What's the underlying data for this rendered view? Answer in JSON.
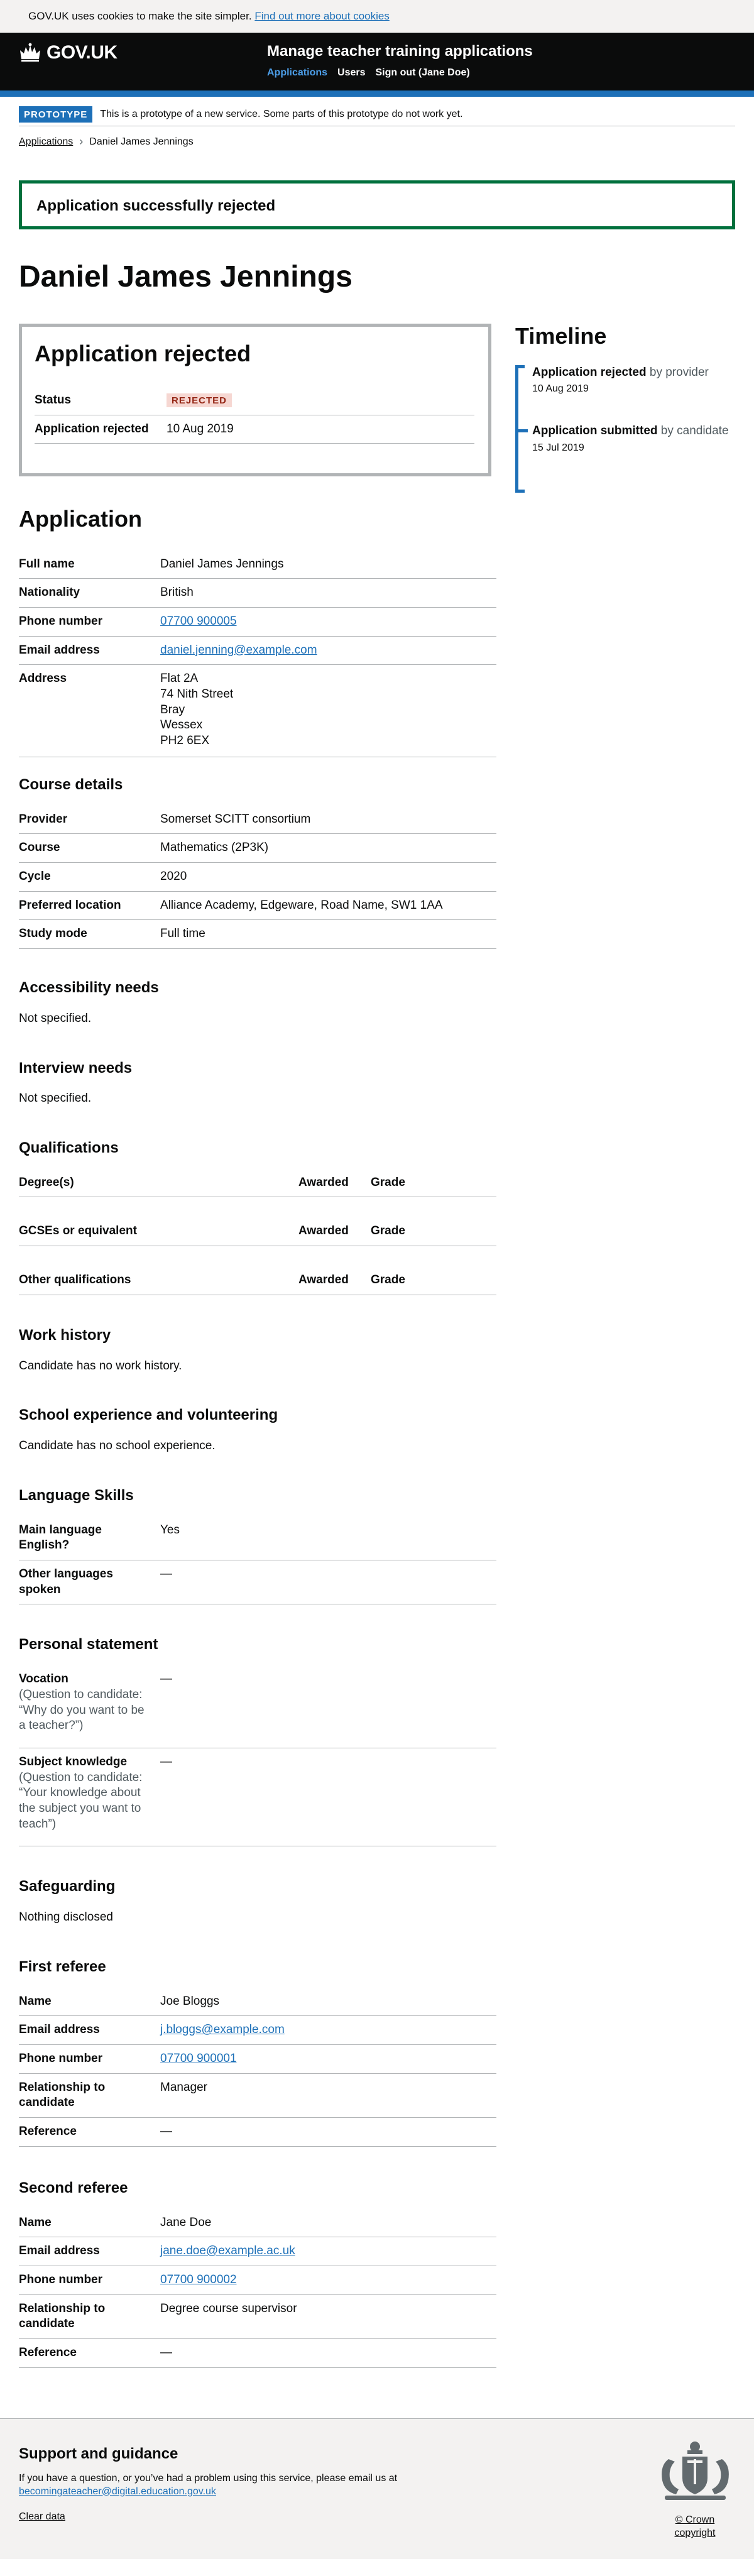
{
  "cookie": {
    "text": "GOV.UK uses cookies to make the site simpler.",
    "link": "Find out more about cookies"
  },
  "header": {
    "logo": "GOV.UK",
    "service": "Manage teacher training applications",
    "nav": [
      "Applications",
      "Users",
      "Sign out (Jane Doe)"
    ]
  },
  "phase": {
    "tag": "PROTOTYPE",
    "text": "This is a prototype of a new service. Some parts of this prototype do not work yet."
  },
  "breadcrumb": [
    "Applications",
    "Daniel James Jennings"
  ],
  "success": "Application successfully rejected",
  "candidate_name": "Daniel James Jennings",
  "status_panel": {
    "title": "Application rejected",
    "rows": [
      {
        "key": "Status",
        "value": "REJECTED"
      },
      {
        "key": "Application rejected",
        "value": "10 Aug 2019"
      }
    ]
  },
  "timeline": {
    "title": "Timeline",
    "items": [
      {
        "event": "Application rejected",
        "by": "by provider",
        "date": "10 Aug 2019"
      },
      {
        "event": "Application submitted",
        "by": "by candidate",
        "date": "15 Jul 2019"
      }
    ]
  },
  "application": {
    "title": "Application",
    "rows": [
      {
        "key": "Full name",
        "value": "Daniel James Jennings"
      },
      {
        "key": "Nationality",
        "value": "British"
      },
      {
        "key": "Phone number",
        "value": "07700 900005"
      },
      {
        "key": "Email address",
        "value": "daniel.jenning@example.com"
      },
      {
        "key": "Address",
        "lines": [
          "Flat 2A",
          "74 Nith Street",
          "Bray",
          "Wessex",
          "PH2 6EX"
        ]
      }
    ]
  },
  "course": {
    "title": "Course details",
    "rows": [
      {
        "key": "Provider",
        "value": "Somerset SCITT consortium"
      },
      {
        "key": "Course",
        "value": "Mathematics (2P3K)"
      },
      {
        "key": "Cycle",
        "value": "2020"
      },
      {
        "key": "Preferred location",
        "value": "Alliance Academy, Edgeware, Road Name, SW1 1AA"
      },
      {
        "key": "Study mode",
        "value": "Full time"
      }
    ]
  },
  "accessibility": {
    "title": "Accessibility needs",
    "text": "Not specified."
  },
  "interview": {
    "title": "Interview needs",
    "text": "Not specified."
  },
  "qualifications": {
    "title": "Qualifications",
    "groups": [
      {
        "name": "Degree(s)",
        "awarded": "Awarded",
        "grade": "Grade"
      },
      {
        "name": "GCSEs or equivalent",
        "awarded": "Awarded",
        "grade": "Grade"
      },
      {
        "name": "Other qualifications",
        "awarded": "Awarded",
        "grade": "Grade"
      }
    ]
  },
  "work": {
    "title": "Work history",
    "text": "Candidate has no work history."
  },
  "school": {
    "title": "School experience and volunteering",
    "text": "Candidate has no school experience."
  },
  "language": {
    "title": "Language Skills",
    "rows": [
      {
        "key": "Main language English?",
        "value": "Yes"
      },
      {
        "key": "Other languages spoken",
        "value": "—"
      }
    ]
  },
  "statement": {
    "title": "Personal statement",
    "rows": [
      {
        "key": "Vocation",
        "note": "(Question to candidate: “Why do you want to be a teacher?”)",
        "value": "—"
      },
      {
        "key": "Subject knowledge",
        "note": "(Question to candidate: “Your knowledge about the subject you want to teach”)",
        "value": "—"
      }
    ]
  },
  "safeguarding": {
    "title": "Safeguarding",
    "text": "Nothing disclosed"
  },
  "referee1": {
    "title": "First referee",
    "rows": [
      {
        "key": "Name",
        "value": "Joe Bloggs"
      },
      {
        "key": "Email address",
        "value": "j.bloggs@example.com"
      },
      {
        "key": "Phone number",
        "value": "07700 900001"
      },
      {
        "key": "Relationship to candidate",
        "value": "Manager"
      },
      {
        "key": "Reference",
        "value": "—"
      }
    ]
  },
  "referee2": {
    "title": "Second referee",
    "rows": [
      {
        "key": "Name",
        "value": "Jane Doe"
      },
      {
        "key": "Email address",
        "value": "jane.doe@example.ac.uk"
      },
      {
        "key": "Phone number",
        "value": "07700 900002"
      },
      {
        "key": "Relationship to candidate",
        "value": "Degree course supervisor"
      },
      {
        "key": "Reference",
        "value": "—"
      }
    ]
  },
  "footer": {
    "title": "Support and guidance",
    "text": "If you have a question, or you’ve had a problem using this service, please email us at",
    "email": "becomingateacher@digital.education.gov.uk",
    "clear": "Clear data",
    "copyright": "© Crown copyright"
  },
  "colors": {
    "brand_blue": "#1d70b8",
    "success_green": "#00703c",
    "rejected_bg": "#f6d7d2",
    "rejected_text": "#942514"
  }
}
